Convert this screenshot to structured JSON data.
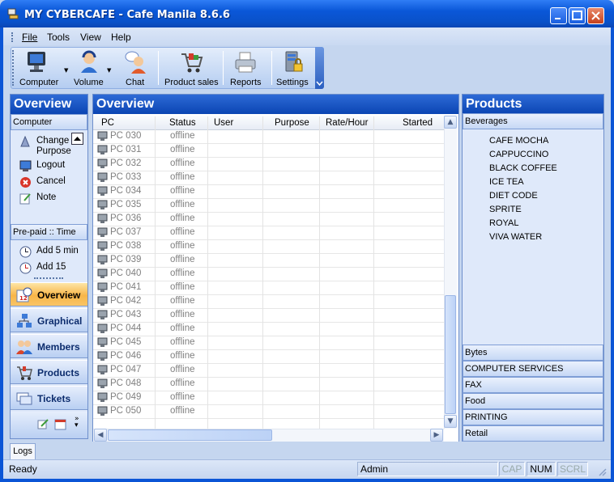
{
  "window": {
    "title": "MY CYBERCAFE - Cafe Manila 8.6.6"
  },
  "menu": [
    {
      "label": "File"
    },
    {
      "label": "Tools"
    },
    {
      "label": "View"
    },
    {
      "label": "Help"
    }
  ],
  "toolbar": [
    {
      "label": "Computer"
    },
    {
      "label": "Volume"
    },
    {
      "label": "Chat"
    },
    {
      "label": "Product sales"
    },
    {
      "label": "Reports"
    },
    {
      "label": "Settings"
    }
  ],
  "left_panel": {
    "title": "Overview",
    "computer_section": "Computer",
    "computer_actions": [
      {
        "label": "Change Purpose"
      },
      {
        "label": "Logout"
      },
      {
        "label": "Cancel"
      },
      {
        "label": "Note"
      }
    ],
    "prepaid_section": "Pre-paid :: Time",
    "prepaid_actions": [
      {
        "label": "Add 5 min"
      },
      {
        "label": "Add 15"
      }
    ],
    "nav": [
      {
        "label": "Overview"
      },
      {
        "label": "Graphical"
      },
      {
        "label": "Members"
      },
      {
        "label": "Products"
      },
      {
        "label": "Tickets"
      }
    ]
  },
  "overview": {
    "title": "Overview",
    "columns": [
      "PC",
      "Status",
      "User",
      "Purpose",
      "Rate/Hour",
      "Started"
    ],
    "rows": [
      {
        "pc": "PC 030",
        "status": "offline"
      },
      {
        "pc": "PC 031",
        "status": "offline"
      },
      {
        "pc": "PC 032",
        "status": "offline"
      },
      {
        "pc": "PC 033",
        "status": "offline"
      },
      {
        "pc": "PC 034",
        "status": "offline"
      },
      {
        "pc": "PC 035",
        "status": "offline"
      },
      {
        "pc": "PC 036",
        "status": "offline"
      },
      {
        "pc": "PC 037",
        "status": "offline"
      },
      {
        "pc": "PC 038",
        "status": "offline"
      },
      {
        "pc": "PC 039",
        "status": "offline"
      },
      {
        "pc": "PC 040",
        "status": "offline"
      },
      {
        "pc": "PC 041",
        "status": "offline"
      },
      {
        "pc": "PC 042",
        "status": "offline"
      },
      {
        "pc": "PC 043",
        "status": "offline"
      },
      {
        "pc": "PC 044",
        "status": "offline"
      },
      {
        "pc": "PC 045",
        "status": "offline"
      },
      {
        "pc": "PC 046",
        "status": "offline"
      },
      {
        "pc": "PC 047",
        "status": "offline"
      },
      {
        "pc": "PC 048",
        "status": "offline"
      },
      {
        "pc": "PC 049",
        "status": "offline"
      },
      {
        "pc": "PC 050",
        "status": "offline"
      }
    ]
  },
  "products": {
    "title": "Products",
    "open_category": "Beverages",
    "items": [
      "CAFE MOCHA",
      "CAPPUCCINO",
      "BLACK COFFEE",
      "ICE TEA",
      "DIET CODE",
      "SPRITE",
      "ROYAL",
      "VIVA WATER"
    ],
    "categories": [
      "Bytes",
      "COMPUTER SERVICES",
      "FAX",
      "Food",
      "PRINTING",
      "Retail"
    ]
  },
  "logs_tab": "Logs",
  "status": {
    "state": "Ready",
    "user": "Admin",
    "caps": "CAP",
    "num": "NUM",
    "scroll": "SCRL"
  },
  "colors": {
    "title_blue": "#0a57d8",
    "panel_head": "#0b45b3",
    "active_nav": "#f8b648"
  }
}
